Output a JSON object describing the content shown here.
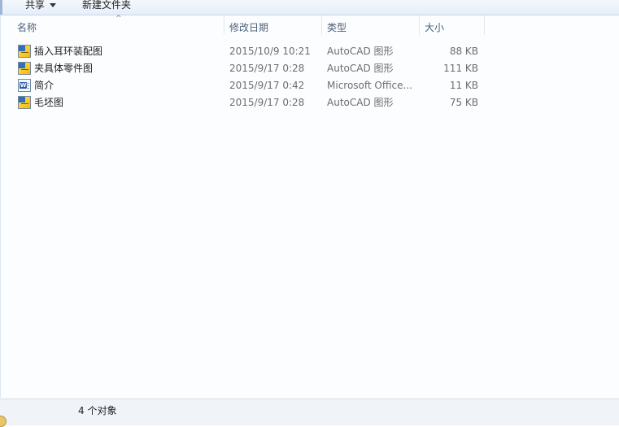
{
  "toolbar": {
    "share_label": "共享",
    "new_folder_label": "新建文件夹"
  },
  "columns": {
    "name": "名称",
    "date": "修改日期",
    "type": "类型",
    "size": "大小"
  },
  "files": [
    {
      "name": "插入耳环装配图",
      "date": "2015/10/9 10:21",
      "type": "AutoCAD 图形",
      "size": "88 KB",
      "icon": "autocad-drawing-icon"
    },
    {
      "name": "夹具体零件图",
      "date": "2015/9/17 0:28",
      "type": "AutoCAD 图形",
      "size": "111 KB",
      "icon": "autocad-drawing-icon"
    },
    {
      "name": "简介",
      "date": "2015/9/17 0:42",
      "type": "Microsoft Office...",
      "size": "11 KB",
      "icon": "word-document-icon"
    },
    {
      "name": "毛坯图",
      "date": "2015/9/17 0:28",
      "type": "AutoCAD 图形",
      "size": "75 KB",
      "icon": "autocad-drawing-icon"
    }
  ],
  "status": {
    "item_count": "4 个对象"
  }
}
